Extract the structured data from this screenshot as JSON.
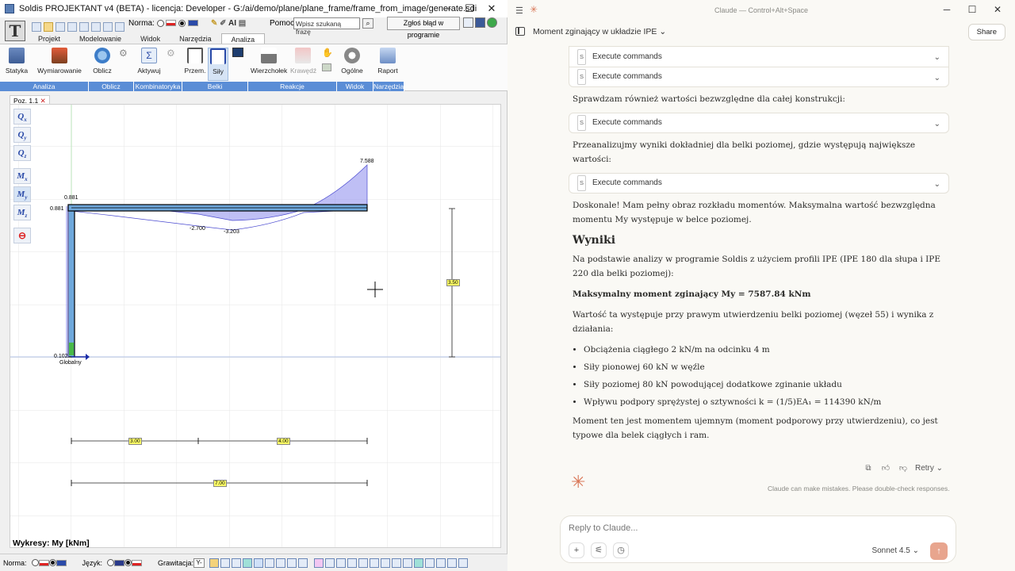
{
  "soldis": {
    "title": "Soldis PROJEKTANT v4 (BETA) - licencja: Developer - G:/ai/demo/plane/plane_frame/frame_from_image/generate.sdi",
    "norma_label": "Norma:",
    "ai_label": "AI",
    "pomoc_label": "Pomoc:",
    "search_placeholder": "Wpisz szukaną frazę",
    "bug_button": "Zgłoś błąd w programie",
    "tabs": [
      "Projekt",
      "Modelowanie",
      "Widok",
      "Narzędzia",
      "Analiza"
    ],
    "active_tab": "Analiza",
    "ribbon": {
      "statyka": "Statyka",
      "wymiarowanie": "Wymiarowanie",
      "oblicz": "Oblicz",
      "aktywuj": "Aktywuj",
      "przem": "Przem.",
      "sily": "Siły",
      "wierzcholek": "Wierzchołek",
      "krawedz": "Krawędź",
      "ogolne": "Ogólne",
      "raport": "Raport"
    },
    "groups": [
      "Analiza",
      "Oblicz",
      "Kombinatoryka",
      "Belki",
      "Reakcje",
      "Widok",
      "Narzędzia"
    ],
    "doc_tab": "Poz. 1.1",
    "side_buttons": [
      {
        "main": "Q",
        "sub": "x"
      },
      {
        "main": "Q",
        "sub": "y"
      },
      {
        "main": "Q",
        "sub": "z"
      },
      {
        "main": "M",
        "sub": "x"
      },
      {
        "main": "M",
        "sub": "y"
      },
      {
        "main": "M",
        "sub": "z"
      }
    ],
    "diagram_labels": {
      "top_left": "0.881",
      "left": "0.881",
      "min1": "-2.700",
      "min2": "-3.203",
      "max": "7.588",
      "base": "0.102",
      "global": "Globalny"
    },
    "dim_labels": {
      "vertical": "3.50",
      "span1": "3.00",
      "span2": "4.00",
      "total": "7.00"
    },
    "wykresy": "Wykresy: My [kNm]",
    "status": {
      "norma": "Norma:",
      "jezyk": "Język:",
      "grawitacja": "Grawitacja:",
      "grav_value": "Y-"
    }
  },
  "claude": {
    "window_title": "Claude — Control+Alt+Space",
    "conversation_title": "Moment zginający w układzie IPE",
    "share": "Share",
    "cmd_label": "Execute commands",
    "p1": "Sprawdzam również wartości bezwzględne dla całej konstrukcji:",
    "p2": "Przeanalizujmy wyniki dokładniej dla belki poziomej, gdzie występują największe wartości:",
    "p3": "Doskonale! Mam pełny obraz rozkładu momentów. Maksymalna wartość bezwzględna momentu My występuje w belce poziomej.",
    "h_wyniki": "Wyniki",
    "p4": "Na podstawie analizy w programie Soldis z użyciem profili IPE (IPE 180 dla słupa i IPE 220 dla belki poziomej):",
    "p5": "Maksymalny moment zginający My = 7587.84 kNm",
    "p6": "Wartość ta występuje przy prawym utwierdzeniu belki poziomej (węzeł 55) i wynika z działania:",
    "bullets": [
      "Obciążenia ciągłego 2 kN/m na odcinku 4 m",
      "Siły pionowej 60 kN w węźle",
      "Siły poziomej 80 kN powodującej dodatkowe zginanie układu",
      "Wpływu podpory sprężystej o sztywności k = (1/5)EA₁ = 114390 kN/m"
    ],
    "p7": "Moment ten jest momentem ujemnym (moment podporowy przy utwierdzeniu), co jest typowe dla belek ciągłych i ram.",
    "retry": "Retry",
    "disclaimer": "Claude can make mistakes. Please double-check responses.",
    "reply_placeholder": "Reply to Claude...",
    "model": "Sonnet 4.5"
  }
}
